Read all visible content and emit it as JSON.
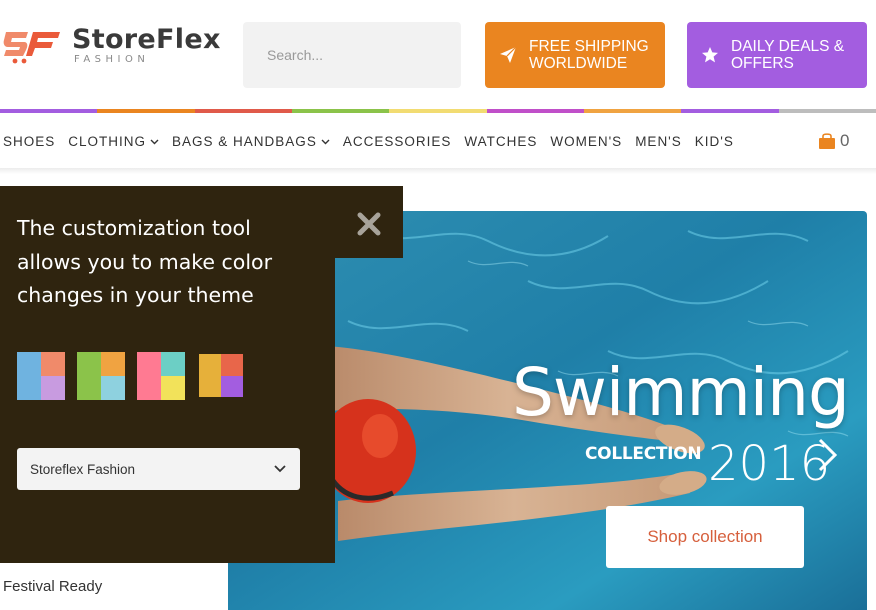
{
  "brand": {
    "name": "StoreFlex",
    "tagline": "FASHION",
    "mark": "SF"
  },
  "search": {
    "placeholder": "Search..."
  },
  "promos": [
    {
      "label_line1": "FREE SHIPPING",
      "label_line2": "WORLDWIDE",
      "icon": "paper-plane-icon",
      "color": "#ea8520"
    },
    {
      "label_line1": "DAILY DEALS &",
      "label_line2": "OFFERS",
      "icon": "star-icon",
      "color": "#a35de0"
    }
  ],
  "stripe_colors": [
    "#a35de0",
    "#ea8520",
    "#e05a4a",
    "#8bc34a",
    "#f2dc72",
    "#c04fc9",
    "#f0a341",
    "#a35de0",
    "#bdbdbd"
  ],
  "nav": {
    "items": [
      {
        "label": "SHOES",
        "dropdown": false
      },
      {
        "label": "CLOTHING",
        "dropdown": true
      },
      {
        "label": "BAGS & HANDBAGS",
        "dropdown": true
      },
      {
        "label": "ACCESSORIES",
        "dropdown": false
      },
      {
        "label": "WATCHES",
        "dropdown": false
      },
      {
        "label": "WOMEN'S",
        "dropdown": false
      },
      {
        "label": "MEN'S",
        "dropdown": false
      },
      {
        "label": "KID'S",
        "dropdown": false
      }
    ],
    "cart_count": "0"
  },
  "hero": {
    "title": "Swimming",
    "subtitle": "COLLECTION",
    "year": "2016",
    "button": "Shop collection"
  },
  "side": {
    "text": "Festival Ready"
  },
  "panel": {
    "text": "The customization tool allows you to make color changes in your theme",
    "swatches": [
      [
        "#6fb3e0",
        "#f08a6a",
        "#6fb3e0",
        "#c89be0"
      ],
      [
        "#8bc34a",
        "#f0a341",
        "#8bc34a",
        "#8ed1df"
      ],
      [
        "#ff7a92",
        "#6ccfc5",
        "#ff7a92",
        "#f2e25a"
      ],
      [
        "#e6b03a",
        "#e8664a",
        "#e6b03a",
        "#a35de0"
      ]
    ],
    "select_value": "Storeflex Fashion"
  }
}
